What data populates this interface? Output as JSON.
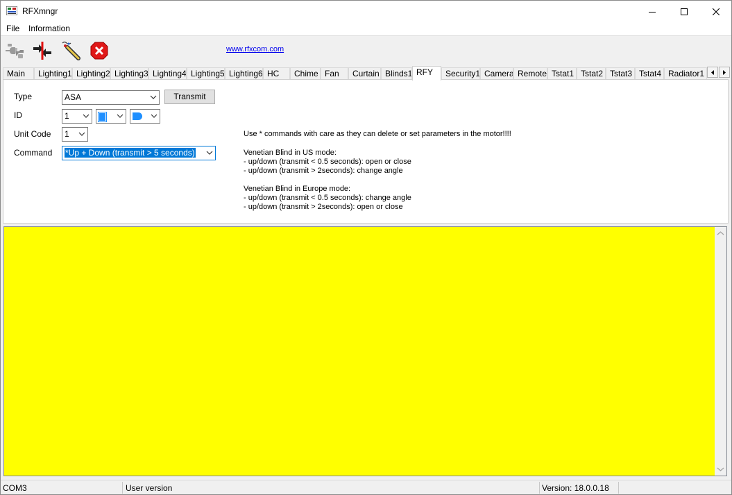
{
  "window": {
    "title": "RFXmngr"
  },
  "menu": {
    "file": "File",
    "information": "Information"
  },
  "toolbar": {
    "link": "www.rfxcom.com"
  },
  "tabs": [
    "Main",
    "Lighting1",
    "Lighting2",
    "Lighting3",
    "Lighting4",
    "Lighting5",
    "Lighting6",
    "HC",
    "Chime",
    "Fan",
    "Curtain",
    "Blinds1",
    "RFY",
    "Security1",
    "Camera",
    "Remote",
    "Tstat1",
    "Tstat2",
    "Tstat3",
    "Tstat4",
    "Radiator1"
  ],
  "active_tab": "RFY",
  "form": {
    "type_label": "Type",
    "type_value": "ASA",
    "transmit_label": "Transmit",
    "id_label": "ID",
    "id1_value": "1",
    "unit_code_label": "Unit Code",
    "unit_code_value": "1",
    "command_label": "Command",
    "command_value": "*Up + Down (transmit > 5 seconds)"
  },
  "info": {
    "warning": "Use * commands with care as they can delete or set parameters in the motor!!!!",
    "us_title": "Venetian Blind in US mode:",
    "us_line1": "- up/down (transmit < 0.5 seconds): open or close",
    "us_line2": "- up/down (transmit > 2seconds): change angle",
    "eu_title": "Venetian Blind in Europe mode:",
    "eu_line1": "- up/down (transmit < 0.5 seconds): change angle",
    "eu_line2": "- up/down (transmit > 2seconds): open or close"
  },
  "status": {
    "port": "COM3",
    "mode": "User version",
    "version": "Version: 18.0.0.18"
  },
  "colors": {
    "log_background": "#ffff00",
    "selection": "#0078d7",
    "id2_swatch": "#1e8fff",
    "id3_swatch": "#1e8fff"
  },
  "icons": [
    "connect-icon",
    "disconnect-icon",
    "debug-icon",
    "stop-icon"
  ]
}
